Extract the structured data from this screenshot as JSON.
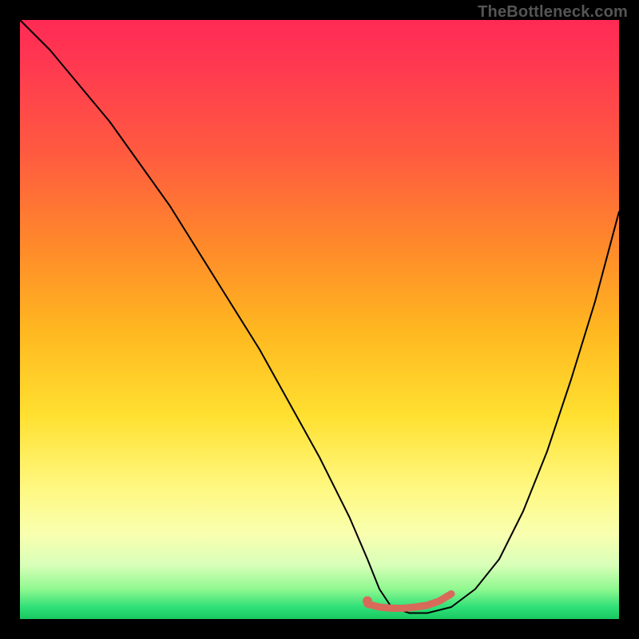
{
  "watermark": "TheBottleneck.com",
  "chart_data": {
    "type": "line",
    "title": "",
    "xlabel": "",
    "ylabel": "",
    "xlim": [
      0,
      100
    ],
    "ylim": [
      0,
      100
    ],
    "series": [
      {
        "name": "bottleneck-curve",
        "x": [
          0,
          5,
          10,
          15,
          20,
          25,
          30,
          35,
          40,
          45,
          50,
          55,
          58,
          60,
          62,
          65,
          68,
          72,
          76,
          80,
          84,
          88,
          92,
          96,
          100
        ],
        "y": [
          100,
          95,
          89,
          83,
          76,
          69,
          61,
          53,
          45,
          36,
          27,
          17,
          10,
          5,
          2,
          1,
          1,
          2,
          5,
          10,
          18,
          28,
          40,
          53,
          68
        ],
        "color": "#000000",
        "width": 2
      },
      {
        "name": "highlight-segment",
        "x": [
          58,
          60,
          62,
          64,
          66,
          68,
          70,
          72
        ],
        "y": [
          2.5,
          2.0,
          1.8,
          1.8,
          2.0,
          2.3,
          3.0,
          4.2
        ],
        "color": "#d86a5a",
        "width": 9
      }
    ],
    "markers": [
      {
        "name": "highlight-start-dot",
        "x": 58,
        "y": 3.0,
        "r": 6,
        "color": "#d86a5a"
      }
    ]
  }
}
